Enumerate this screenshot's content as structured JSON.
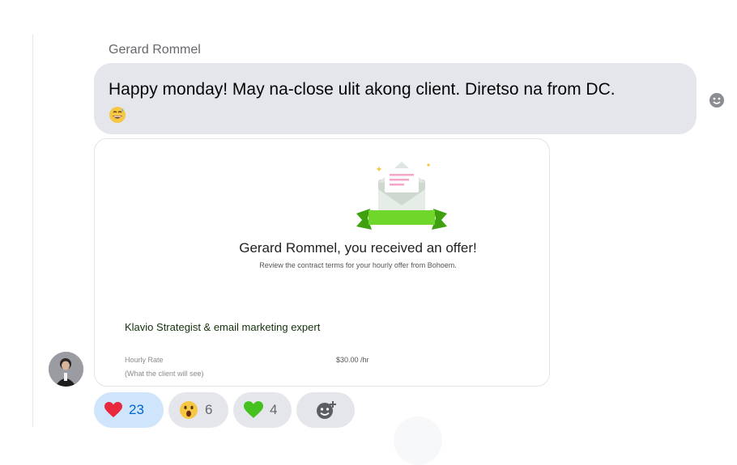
{
  "message": {
    "sender": "Gerard Rommel",
    "text": "Happy monday! May na-close ulit akong client. Diretso na from DC."
  },
  "offer_card": {
    "title": "Gerard Rommel, you received an offer!",
    "subtitle": "Review the contract terms for your hourly offer from Bohoem.",
    "job_title": "Klavio Strategist & email marketing expert",
    "rate_label": "Hourly Rate",
    "rate_note": "(What the client will see)",
    "rate_value": "$30.00 /hr"
  },
  "reactions": [
    {
      "icon": "heart-icon",
      "count": "23",
      "active": true
    },
    {
      "icon": "surprised-face-icon",
      "count": "6",
      "active": false
    },
    {
      "icon": "green-heart-icon",
      "count": "4",
      "active": false
    }
  ],
  "colors": {
    "bubble": "#e4e6eb",
    "active_reaction_bg": "#cfe5fb",
    "active_reaction_text": "#0064d1",
    "ribbon_green": "#5fcf1e"
  }
}
